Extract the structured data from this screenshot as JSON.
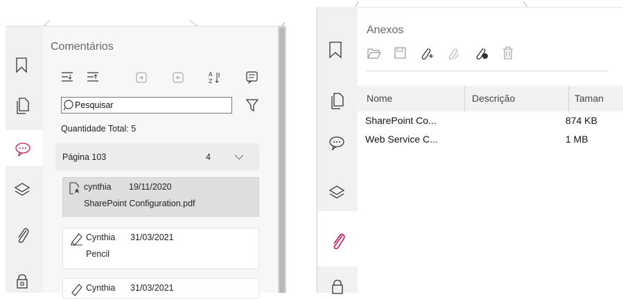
{
  "comments_panel": {
    "title": "Comentários",
    "search_placeholder": "Pesquisar",
    "total_label": "Quantidade Total: 5",
    "toolbar_icons": [
      "expand-all-icon",
      "collapse-all-icon",
      "next-icon",
      "previous-icon",
      "sort-icon",
      "summary-icon"
    ],
    "filter_icon": "filter-icon",
    "group": {
      "label": "Página 103",
      "count": "4"
    },
    "items": [
      {
        "icon": "attachment-comment-icon",
        "author": "cynthia",
        "date": "19/11/2020",
        "text": "SharePoint Configuration.pdf",
        "selected": true
      },
      {
        "icon": "pencil-icon",
        "author": "Cynthia",
        "date": "31/03/2021",
        "text": "Pencil",
        "selected": false
      },
      {
        "icon": "pencil-icon",
        "author": "Cynthia",
        "date": "31/03/2021",
        "text": "",
        "selected": false
      }
    ]
  },
  "left_rail": [
    "bookmark-icon",
    "pages-icon",
    "comments-icon",
    "layers-icon",
    "attachments-icon",
    "security-icon"
  ],
  "right_rail": [
    "bookmark-icon",
    "pages-icon",
    "comments-icon",
    "layers-icon",
    "attachments-icon",
    "security-icon"
  ],
  "attachments_panel": {
    "title": "Anexos",
    "toolbar_icons": [
      "open-icon",
      "save-icon",
      "add-attachment-icon",
      "edit-attachment-icon",
      "add-file-attachment-icon",
      "delete-icon"
    ],
    "columns": [
      "Nome",
      "Descrição",
      "Taman"
    ],
    "rows": [
      {
        "name": "SharePoint Co...",
        "description": "",
        "size": "874 KB"
      },
      {
        "name": "Web Service C...",
        "description": "",
        "size": "1 MB"
      }
    ]
  },
  "colors": {
    "accent": "#c2185b",
    "rail": "#f1f1f1",
    "panel": "#f7f7f7"
  }
}
